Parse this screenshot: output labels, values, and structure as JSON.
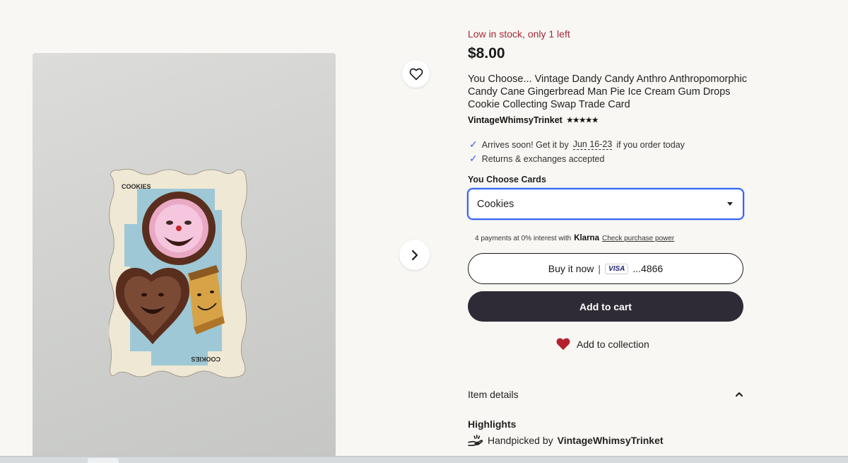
{
  "gallery": {
    "card_label_top": "COOKIES",
    "card_label_bottom": "COOKIES"
  },
  "listing": {
    "stock_status": "Low in stock, only 1 left",
    "price": "$8.00",
    "title": "You Choose... Vintage Dandy Candy Anthro Anthropomorphic Candy Cane Gingerbread Man Pie Ice Cream Gum Drops Cookie Collecting Swap Trade Card",
    "seller": "VintageWhimsyTrinket",
    "rating_stars": "★★★★★"
  },
  "shipping": {
    "arrives_prefix": "Arrives soon! Get it by",
    "arrives_dates": "Jun 16-23",
    "arrives_suffix": "if you order today",
    "returns": "Returns & exchanges accepted"
  },
  "variant": {
    "label": "You Choose Cards",
    "selected": "Cookies"
  },
  "klarna": {
    "prefix": "4 payments at 0% interest with",
    "brand": "Klarna",
    "link": "Check purchase power"
  },
  "actions": {
    "buy_now_label": "Buy it now",
    "separator": "|",
    "card_brand": "VISA",
    "card_last4": "...4866",
    "add_to_cart_label": "Add to cart",
    "add_to_collection_label": "Add to collection"
  },
  "details": {
    "section_title": "Item details",
    "highlights_title": "Highlights",
    "handpicked_prefix": "Handpicked by",
    "handpicked_seller": "VintageWhimsyTrinket"
  },
  "colors": {
    "accent_blue": "#3665f3",
    "stock_red": "#a52a35",
    "cart_button": "#2f2b36",
    "heart_red": "#b4212d"
  }
}
